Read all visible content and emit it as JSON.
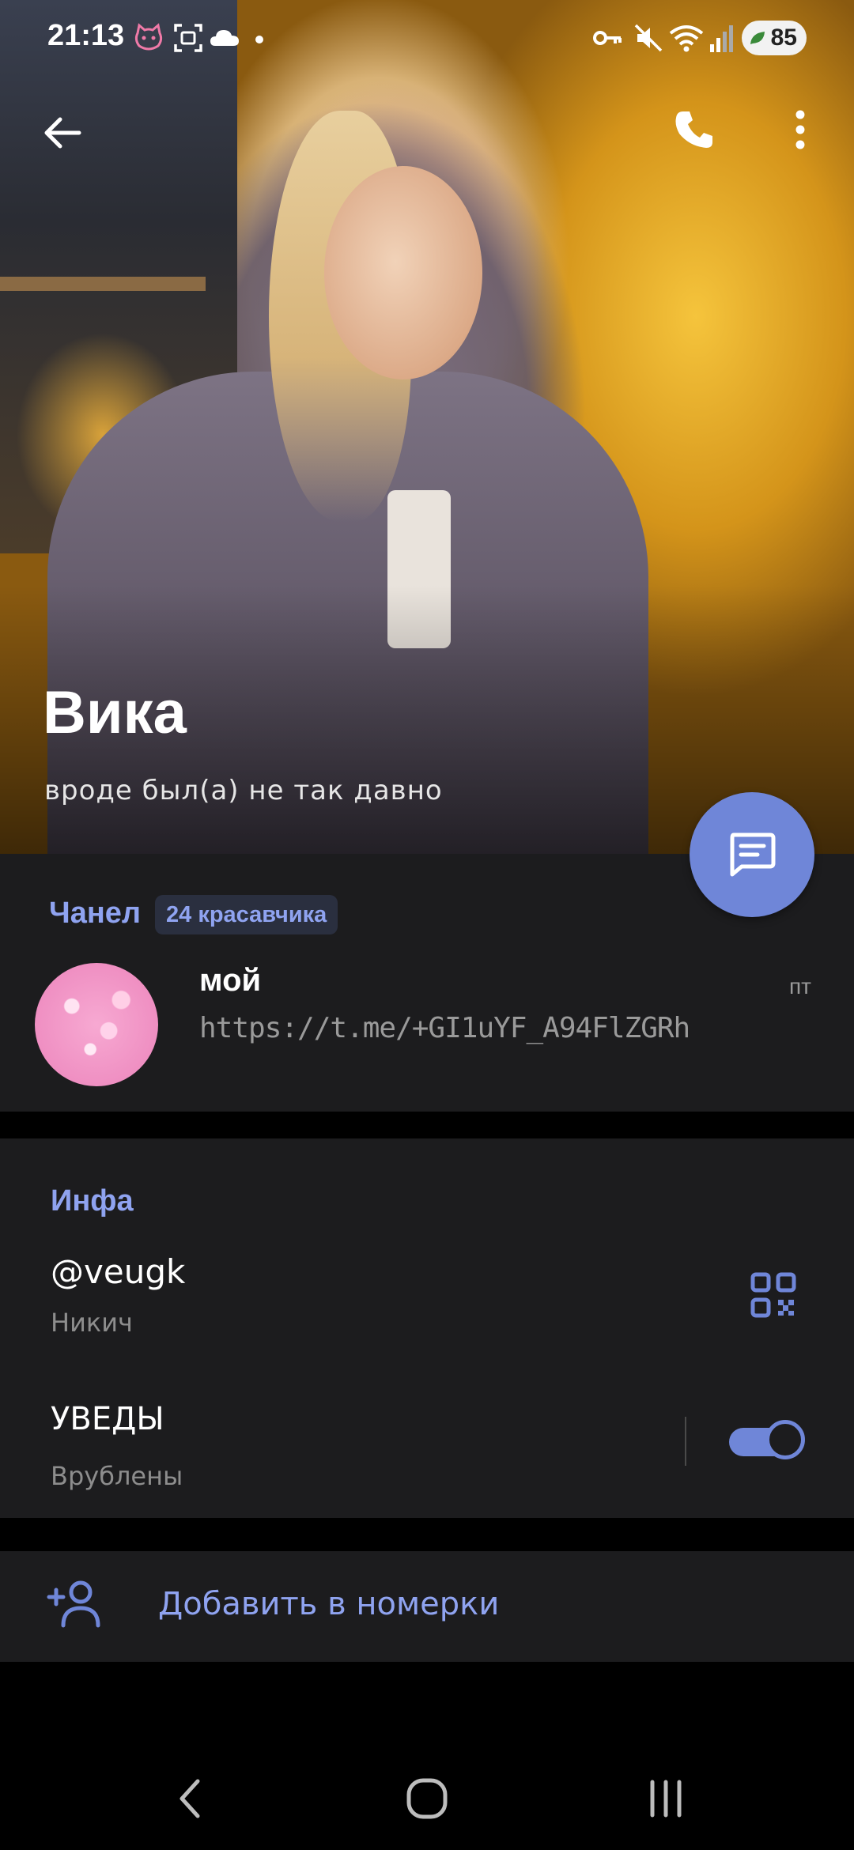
{
  "status_bar": {
    "time": "21:13",
    "battery": "85",
    "icons": [
      "cat-emoji-icon",
      "screenshot-icon",
      "cloud-icon",
      "dot-icon",
      "vpn-key-icon",
      "mute-icon",
      "wifi-icon",
      "signal-icon",
      "battery-icon"
    ]
  },
  "profile": {
    "name": "Вика",
    "last_seen": "вроде был(а) не так давно"
  },
  "channel": {
    "section_title": "Чанел",
    "subscribers": "24 красавчика",
    "name": "мой",
    "link": "https://t.me/+GI1uYF_A94FlZGRh",
    "time": "пт"
  },
  "info": {
    "section_title": "Инфа",
    "username": "@veugk",
    "username_caption": "Никич",
    "notifications_title": "УВЕДЫ",
    "notifications_caption": "Врублены",
    "notifications_enabled": true
  },
  "actions": {
    "add_contact": "Добавить в номерки"
  },
  "colors": {
    "accent": "#8fa3f0",
    "fab": "#6f86d8",
    "card_bg": "#1c1c1e"
  }
}
